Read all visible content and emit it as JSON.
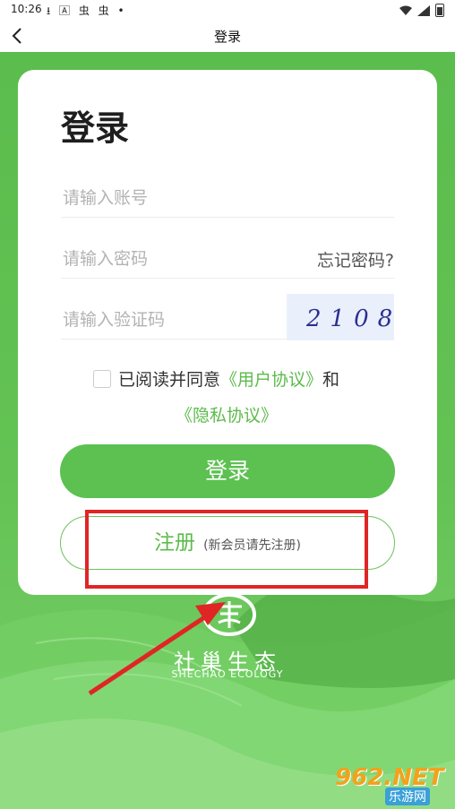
{
  "status_bar": {
    "time": "10:26",
    "left_icons": "⭳ 🄰 虫 虫 •"
  },
  "nav": {
    "title": "登录",
    "back_icon": "chevron-left-icon"
  },
  "card": {
    "title": "登录",
    "account": {
      "placeholder": "请输入账号",
      "value": ""
    },
    "password": {
      "placeholder": "请输入密码",
      "value": "",
      "forgot_label": "忘记密码?"
    },
    "captcha": {
      "placeholder": "请输入验证码",
      "value": "",
      "captcha_text": "2108"
    },
    "agreement": {
      "checked": false,
      "prefix": "已阅读并同意",
      "user_agreement": "《用户协议》",
      "conjunction": "和",
      "privacy_policy": "《隐私协议》"
    },
    "login_button": "登录",
    "register_button": {
      "main": "注册",
      "sub": "(新会员请先注册)"
    }
  },
  "logo": {
    "cn": "社巢生态",
    "en": "SHECHAO ECOLOGY"
  },
  "watermark": {
    "top": "962.NET",
    "bottom": "乐游网"
  },
  "colors": {
    "brand_green": "#5cc151",
    "link_green": "#5cbb4b",
    "annotation_red": "#e02525"
  }
}
